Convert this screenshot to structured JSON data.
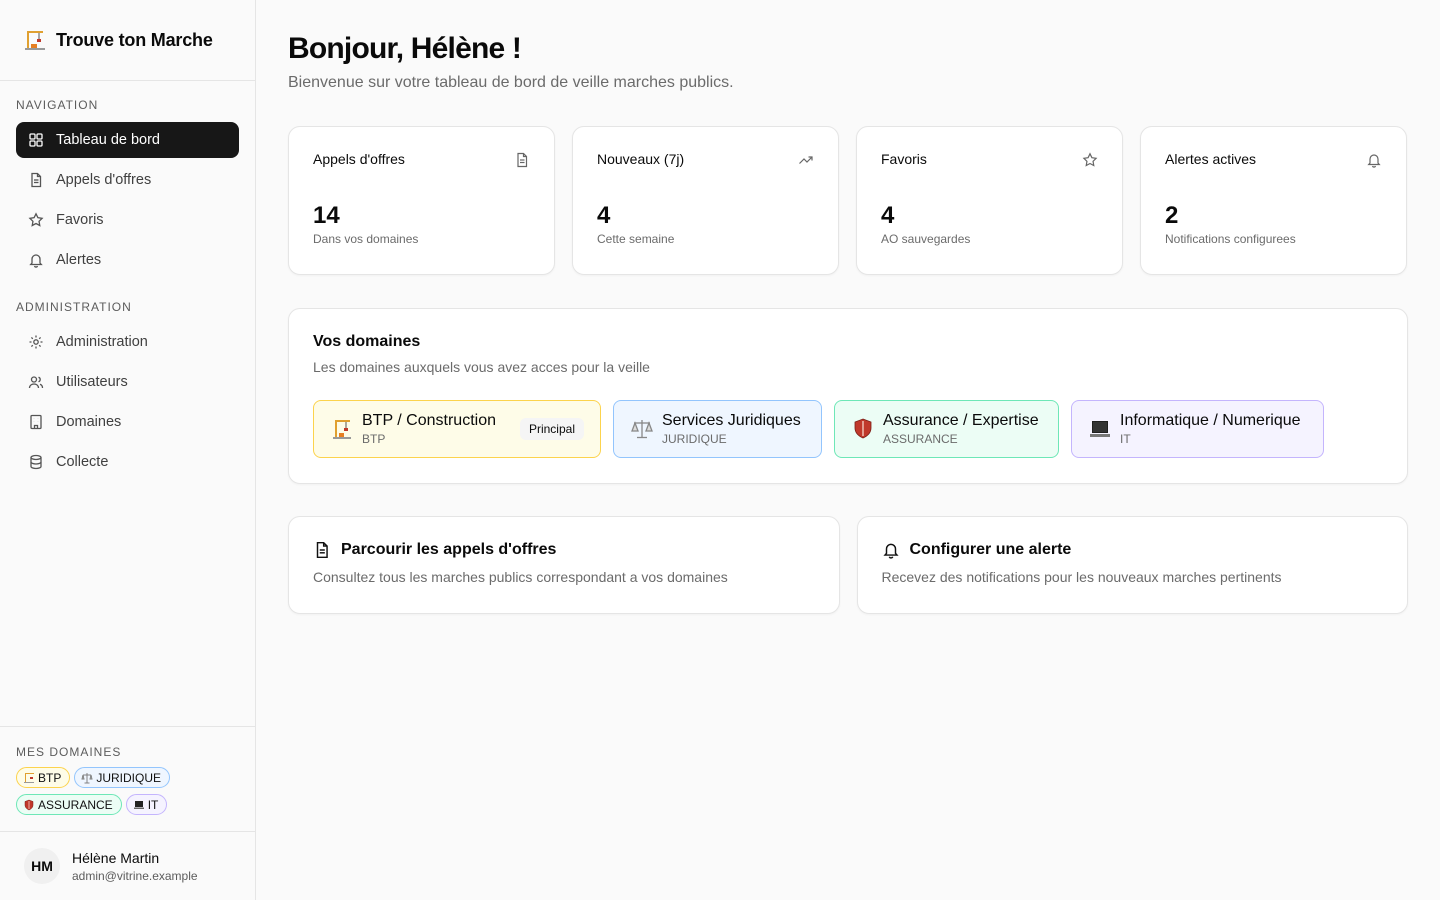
{
  "app": {
    "name": "Trouve ton Marche",
    "logo_icon": "construction-crane"
  },
  "sidebar": {
    "nav_label": "NAVIGATION",
    "nav_items": [
      {
        "label": "Tableau de bord",
        "icon": "dashboard-icon",
        "active": true
      },
      {
        "label": "Appels d'offres",
        "icon": "document-icon"
      },
      {
        "label": "Favoris",
        "icon": "star-icon"
      },
      {
        "label": "Alertes",
        "icon": "bell-icon"
      }
    ],
    "admin_label": "ADMINISTRATION",
    "admin_items": [
      {
        "label": "Administration",
        "icon": "gear-icon"
      },
      {
        "label": "Utilisateurs",
        "icon": "users-icon"
      },
      {
        "label": "Domaines",
        "icon": "building-icon"
      },
      {
        "label": "Collecte",
        "icon": "database-icon"
      }
    ],
    "my_domains_label": "MES DOMAINES",
    "my_domains": [
      "BTP",
      "JURIDIQUE",
      "ASSURANCE",
      "IT"
    ]
  },
  "user": {
    "initials": "HM",
    "name": "Hélène Martin",
    "email": "admin@vitrine.example"
  },
  "main": {
    "greeting": "Bonjour, Hélène !",
    "subtitle": "Bienvenue sur votre tableau de bord de veille marches publics.",
    "stats": [
      {
        "title": "Appels d'offres",
        "value": "14",
        "sub": "Dans vos domaines",
        "icon": "document-icon"
      },
      {
        "title": "Nouveaux (7j)",
        "value": "4",
        "sub": "Cette semaine",
        "icon": "trending-up-icon"
      },
      {
        "title": "Favoris",
        "value": "4",
        "sub": "AO sauvegardes",
        "icon": "star-icon"
      },
      {
        "title": "Alertes actives",
        "value": "2",
        "sub": "Notifications configurees",
        "icon": "bell-icon"
      }
    ],
    "domains": {
      "title": "Vos domaines",
      "subtitle": "Les domaines auxquels vous avez acces pour la veille",
      "principal_label": "Principal",
      "items": [
        {
          "name": "BTP / Construction",
          "code": "BTP"
        },
        {
          "name": "Services Juridiques",
          "code": "JURIDIQUE"
        },
        {
          "name": "Assurance / Expertise",
          "code": "ASSURANCE"
        },
        {
          "name": "Informatique / Numerique",
          "code": "IT"
        }
      ]
    },
    "actions": [
      {
        "title": "Parcourir les appels d'offres",
        "sub": "Consultez tous les marches publics correspondant a vos domaines",
        "icon": "document-icon"
      },
      {
        "title": "Configurer une alerte",
        "sub": "Recevez des notifications pour les nouveaux marches pertinents",
        "icon": "bell-icon"
      }
    ]
  },
  "colors": {
    "active_nav": "#171717",
    "btp": "#fcd34d",
    "juridique": "#93c5fd",
    "assurance": "#6ee7b7",
    "it": "#c4b5fd"
  }
}
